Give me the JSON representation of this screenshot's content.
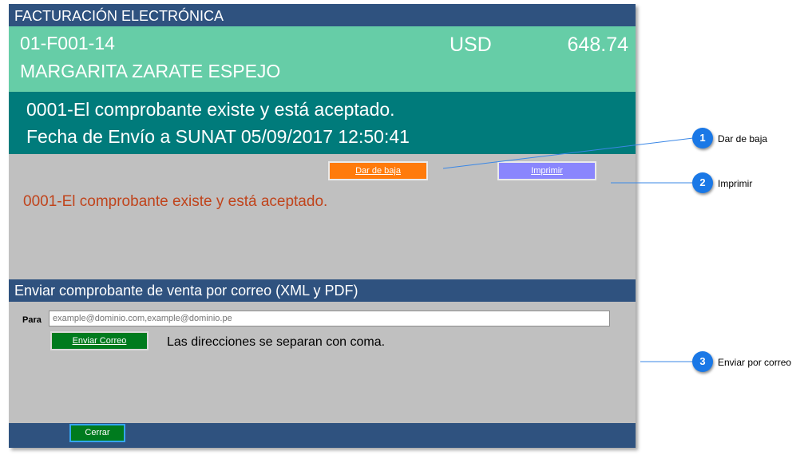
{
  "window": {
    "title": "FACTURACIÓN ELECTRÓNICA"
  },
  "header": {
    "document_number": "01-F001-14",
    "currency": "USD",
    "amount": "648.74",
    "customer_name": "MARGARITA ZARATE ESPEJO"
  },
  "status": {
    "line1": "0001-El comprobante existe y está aceptado.",
    "line2": "Fecha de Envío a SUNAT 05/09/2017 12:50:41"
  },
  "actions": {
    "dar_de_baja": "Dar de baja",
    "imprimir": "Imprimir"
  },
  "message": "0001-El comprobante existe y está aceptado.",
  "email_section": {
    "title": "Enviar comprobante de venta por correo (XML y PDF)",
    "para_label": "Para",
    "placeholder": "example@dominio.com,example@dominio.pe",
    "value": "",
    "send_button": "Enviar Correo",
    "hint": "Las direcciones se separan con coma."
  },
  "footer": {
    "close_button": "Cerrar"
  },
  "callouts": [
    {
      "number": "1",
      "label": "Dar de baja"
    },
    {
      "number": "2",
      "label": "Imprimir"
    },
    {
      "number": "3",
      "label": "Enviar por correo"
    }
  ],
  "colors": {
    "title_bar": "#2f527f",
    "header_bg": "#66cda7",
    "status_bg": "#007b7b",
    "body_bg": "#c0c0c0",
    "baja_button": "#ff7b0b",
    "print_button": "#8a86fd",
    "green_button": "#007b1e",
    "message_text": "#c0441c",
    "callout_badge": "#1a78e6"
  }
}
